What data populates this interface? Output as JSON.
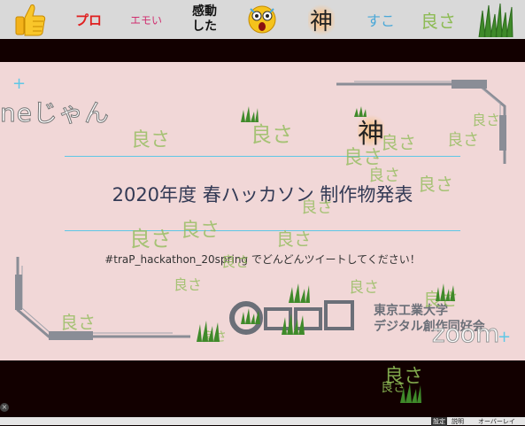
{
  "toolbar": {
    "items": [
      {
        "label": "",
        "icon": "thumbs-up-icon"
      },
      {
        "label": "プロ",
        "color": "#e02020"
      },
      {
        "label": "エモい",
        "color": "#d03070"
      },
      {
        "label": "感動\nした",
        "color": "#111111"
      },
      {
        "label": "",
        "icon": "shocked-face-icon"
      },
      {
        "label": "神",
        "color": "#222222"
      },
      {
        "label": "すこ",
        "color": "#4aa8d8"
      },
      {
        "label": "良さ",
        "color": "#8dbb55"
      },
      {
        "label": "",
        "icon": "grass-icon"
      }
    ]
  },
  "slide": {
    "title": "2020年度 春ハッカソン 制作物発表",
    "hashtag": "#traP_hackathon_20spring でどんどんツイートしてください！",
    "logo_text_line1": "東京工業大学",
    "logo_text_line2": "デジタル創作同好会"
  },
  "overlay": {
    "flowing_text": "neじゃん",
    "kami": "神",
    "yoisa": "良さ",
    "zoom_text": "zoom"
  },
  "statusbar": {
    "items": [
      "設定",
      "説明",
      "オーバーレイ"
    ]
  }
}
